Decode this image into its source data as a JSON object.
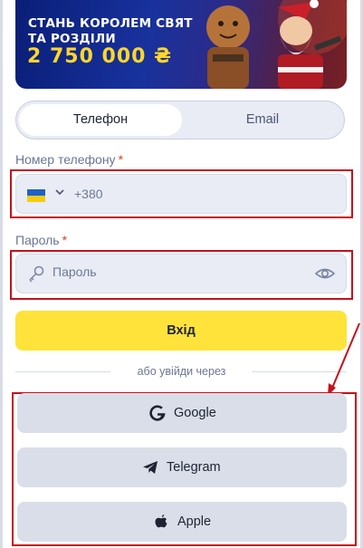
{
  "banner": {
    "line1": "СТАНЬ КОРОЛЕМ СВЯТ",
    "line2": "ТА РОЗДІЛИ",
    "amount": "2 750 000 ₴"
  },
  "tabs": [
    {
      "label": "Телефон",
      "active": true
    },
    {
      "label": "Email",
      "active": false
    }
  ],
  "phone": {
    "label": "Номер телефону",
    "required_mark": "*",
    "country_flag": "ukraine-flag",
    "prefix": "+380"
  },
  "password": {
    "label": "Пароль",
    "required_mark": "*",
    "placeholder": "Пароль"
  },
  "login_button": "Вхід",
  "divider_text": "або увійди через",
  "social": [
    {
      "label": "Google",
      "icon": "google-icon"
    },
    {
      "label": "Telegram",
      "icon": "telegram-icon"
    },
    {
      "label": "Apple",
      "icon": "apple-icon"
    }
  ],
  "colors": {
    "accent_yellow": "#ffe33b",
    "field_bg": "#e9ecf4",
    "highlight_red": "#c8101c",
    "text_dark": "#1e2333",
    "text_muted": "#6b7594"
  }
}
